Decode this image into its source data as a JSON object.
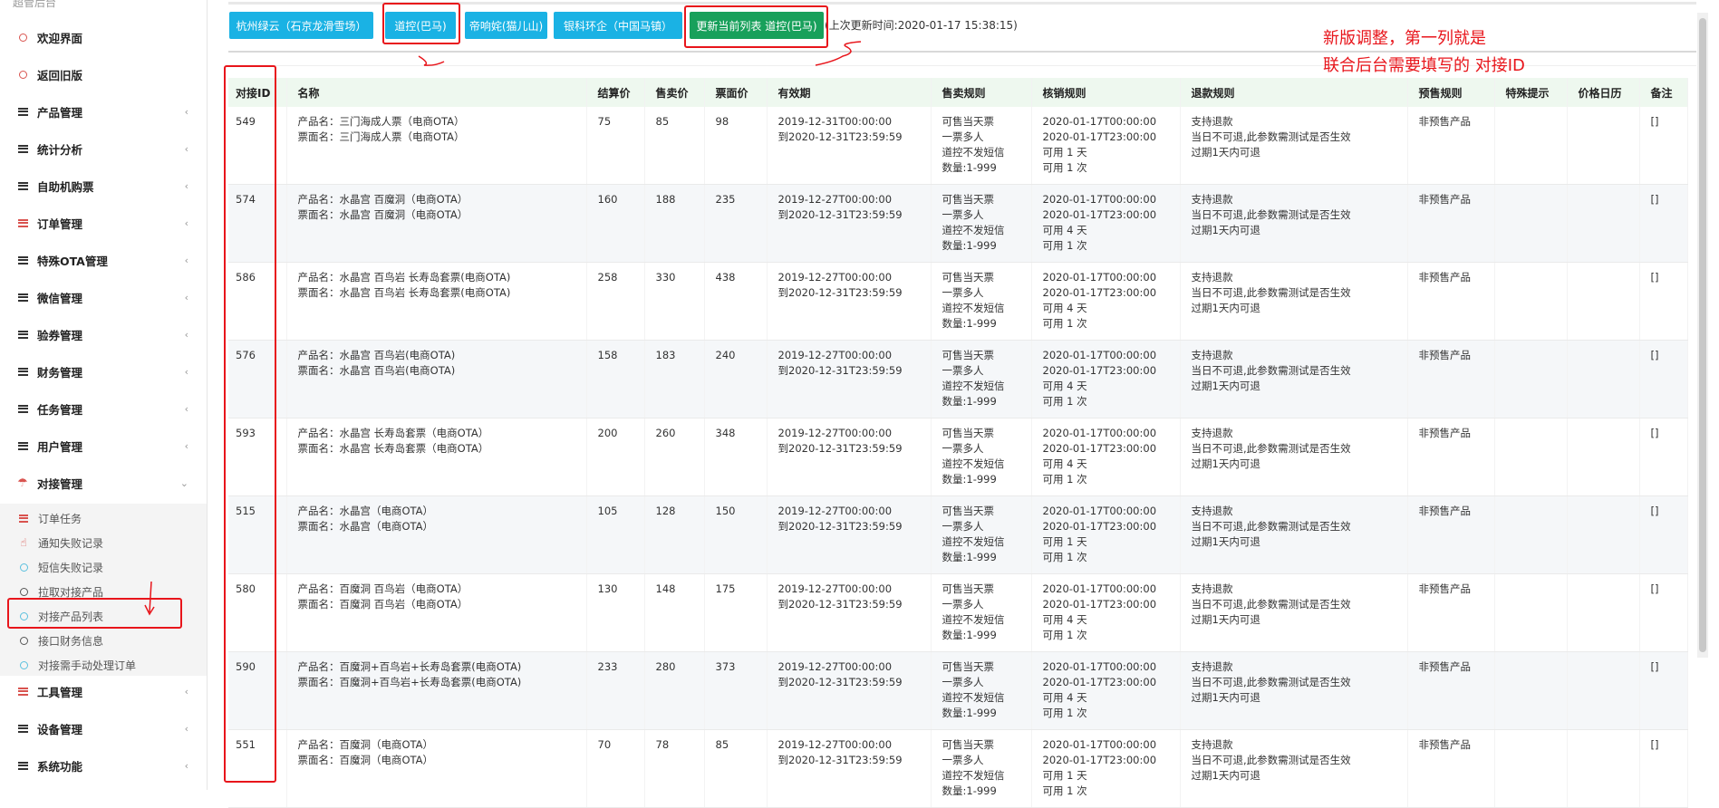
{
  "sidebar": {
    "top_label": "超管后台",
    "items": [
      {
        "label": "欢迎界面",
        "icon": "circle-icon",
        "chev": ""
      },
      {
        "label": "返回旧版",
        "icon": "circle-icon",
        "chev": ""
      },
      {
        "label": "产品管理",
        "icon": "menu-icon",
        "chev": "‹"
      },
      {
        "label": "统计分析",
        "icon": "menu-icon",
        "chev": "‹"
      },
      {
        "label": "自助机购票",
        "icon": "menu-icon",
        "chev": "‹"
      },
      {
        "label": "订单管理",
        "icon": "menu-icon-red",
        "chev": "‹"
      },
      {
        "label": "特殊OTA管理",
        "icon": "menu-icon",
        "chev": "‹"
      },
      {
        "label": "微信管理",
        "icon": "menu-icon",
        "chev": "‹"
      },
      {
        "label": "验券管理",
        "icon": "menu-icon",
        "chev": "‹"
      },
      {
        "label": "财务管理",
        "icon": "menu-icon",
        "chev": "‹"
      },
      {
        "label": "任务管理",
        "icon": "menu-icon",
        "chev": "‹"
      },
      {
        "label": "用户管理",
        "icon": "menu-icon",
        "chev": "‹"
      },
      {
        "label": "对接管理",
        "icon": "umbrella-icon",
        "chev": "⌄"
      }
    ],
    "sub_items": [
      {
        "label": "订单任务",
        "icon": "list-icon"
      },
      {
        "label": "通知失败记录",
        "icon": "hand-icon"
      },
      {
        "label": "短信失败记录",
        "icon": "circle-icon"
      },
      {
        "label": "拉取对接产品",
        "icon": "circle-icon"
      },
      {
        "label": "对接产品列表",
        "icon": "circle-icon"
      },
      {
        "label": "接口财务信息",
        "icon": "circle-icon"
      },
      {
        "label": "对接需手动处理订单",
        "icon": "circle-icon"
      }
    ],
    "bottom_items": [
      {
        "label": "工具管理",
        "icon": "menu-icon-red",
        "chev": "‹"
      },
      {
        "label": "设备管理",
        "icon": "menu-icon",
        "chev": "‹"
      },
      {
        "label": "系统功能",
        "icon": "menu-icon",
        "chev": "‹"
      }
    ]
  },
  "toolbar": {
    "buttons": [
      "杭州绿云（石京龙滑雪场）",
      "道控(巴马)",
      "帝响姹(猫儿山)",
      "银科环企（中国马镇）"
    ],
    "update_button": "更新当前列表 道控(巴马)",
    "last_update": "(上次更新时间:2020-01-17 15:38:15)"
  },
  "table": {
    "headers": [
      "对接ID",
      "名称",
      "结算价",
      "售卖价",
      "票面价",
      "有效期",
      "售卖规则",
      "核销规则",
      "退款规则",
      "预售规则",
      "特殊提示",
      "价格日历",
      "备注"
    ],
    "rows": [
      {
        "id": "549",
        "name": [
          "产品名：三门海成人票（电商OTA）",
          "票面名：三门海成人票（电商OTA）"
        ],
        "settle": "75",
        "sell": "85",
        "face": "98",
        "valid": [
          "2019-12-31T00:00:00",
          "到2020-12-31T23:59:59"
        ],
        "sale": [
          "可售当天票",
          "一票多人",
          "道控不发短信",
          "数量:1-999"
        ],
        "verify": [
          "2020-01-17T00:00:00",
          "2020-01-17T23:00:00",
          "可用 1 天",
          "可用 1 次"
        ],
        "refund": [
          "支持退款",
          "当日不可退,此参数需测试是否生效",
          "过期1天内可退"
        ],
        "presale": "非预售产品",
        "tip": "",
        "cal": "",
        "remark": "[]"
      },
      {
        "id": "574",
        "name": [
          "产品名：水晶宫 百魔洞（电商OTA）",
          "票面名：水晶宫 百魔洞（电商OTA）"
        ],
        "settle": "160",
        "sell": "188",
        "face": "235",
        "valid": [
          "2019-12-27T00:00:00",
          "到2020-12-31T23:59:59"
        ],
        "sale": [
          "可售当天票",
          "一票多人",
          "道控不发短信",
          "数量:1-999"
        ],
        "verify": [
          "2020-01-17T00:00:00",
          "2020-01-17T23:00:00",
          "可用 4 天",
          "可用 1 次"
        ],
        "refund": [
          "支持退款",
          "当日不可退,此参数需测试是否生效",
          "过期1天内可退"
        ],
        "presale": "非预售产品",
        "tip": "",
        "cal": "",
        "remark": "[]"
      },
      {
        "id": "586",
        "name": [
          "产品名：水晶宫 百鸟岩 长寿岛套票(电商OTA)",
          "票面名：水晶宫 百鸟岩 长寿岛套票(电商OTA)"
        ],
        "settle": "258",
        "sell": "330",
        "face": "438",
        "valid": [
          "2019-12-27T00:00:00",
          "到2020-12-31T23:59:59"
        ],
        "sale": [
          "可售当天票",
          "一票多人",
          "道控不发短信",
          "数量:1-999"
        ],
        "verify": [
          "2020-01-17T00:00:00",
          "2020-01-17T23:00:00",
          "可用 4 天",
          "可用 1 次"
        ],
        "refund": [
          "支持退款",
          "当日不可退,此参数需测试是否生效",
          "过期1天内可退"
        ],
        "presale": "非预售产品",
        "tip": "",
        "cal": "",
        "remark": "[]"
      },
      {
        "id": "576",
        "name": [
          "产品名：水晶宫 百鸟岩(电商OTA)",
          "票面名：水晶宫 百鸟岩(电商OTA)"
        ],
        "settle": "158",
        "sell": "183",
        "face": "240",
        "valid": [
          "2019-12-27T00:00:00",
          "到2020-12-31T23:59:59"
        ],
        "sale": [
          "可售当天票",
          "一票多人",
          "道控不发短信",
          "数量:1-999"
        ],
        "verify": [
          "2020-01-17T00:00:00",
          "2020-01-17T23:00:00",
          "可用 4 天",
          "可用 1 次"
        ],
        "refund": [
          "支持退款",
          "当日不可退,此参数需测试是否生效",
          "过期1天内可退"
        ],
        "presale": "非预售产品",
        "tip": "",
        "cal": "",
        "remark": "[]"
      },
      {
        "id": "593",
        "name": [
          "产品名：水晶宫 长寿岛套票（电商OTA）",
          "票面名：水晶宫 长寿岛套票（电商OTA）"
        ],
        "settle": "200",
        "sell": "260",
        "face": "348",
        "valid": [
          "2019-12-27T00:00:00",
          "到2020-12-31T23:59:59"
        ],
        "sale": [
          "可售当天票",
          "一票多人",
          "道控不发短信",
          "数量:1-999"
        ],
        "verify": [
          "2020-01-17T00:00:00",
          "2020-01-17T23:00:00",
          "可用 4 天",
          "可用 1 次"
        ],
        "refund": [
          "支持退款",
          "当日不可退,此参数需测试是否生效",
          "过期1天内可退"
        ],
        "presale": "非预售产品",
        "tip": "",
        "cal": "",
        "remark": "[]"
      },
      {
        "id": "515",
        "name": [
          "产品名：水晶宫（电商OTA）",
          "票面名：水晶宫（电商OTA）"
        ],
        "settle": "105",
        "sell": "128",
        "face": "150",
        "valid": [
          "2019-12-27T00:00:00",
          "到2020-12-31T23:59:59"
        ],
        "sale": [
          "可售当天票",
          "一票多人",
          "道控不发短信",
          "数量:1-999"
        ],
        "verify": [
          "2020-01-17T00:00:00",
          "2020-01-17T23:00:00",
          "可用 1 天",
          "可用 1 次"
        ],
        "refund": [
          "支持退款",
          "当日不可退,此参数需测试是否生效",
          "过期1天内可退"
        ],
        "presale": "非预售产品",
        "tip": "",
        "cal": "",
        "remark": "[]"
      },
      {
        "id": "580",
        "name": [
          "产品名：百魔洞 百鸟岩（电商OTA）",
          "票面名：百魔洞 百鸟岩（电商OTA）"
        ],
        "settle": "130",
        "sell": "148",
        "face": "175",
        "valid": [
          "2019-12-27T00:00:00",
          "到2020-12-31T23:59:59"
        ],
        "sale": [
          "可售当天票",
          "一票多人",
          "道控不发短信",
          "数量:1-999"
        ],
        "verify": [
          "2020-01-17T00:00:00",
          "2020-01-17T23:00:00",
          "可用 4 天",
          "可用 1 次"
        ],
        "refund": [
          "支持退款",
          "当日不可退,此参数需测试是否生效",
          "过期1天内可退"
        ],
        "presale": "非预售产品",
        "tip": "",
        "cal": "",
        "remark": "[]"
      },
      {
        "id": "590",
        "name": [
          "产品名：百魔洞+百鸟岩+长寿岛套票(电商OTA)",
          "票面名：百魔洞+百鸟岩+长寿岛套票(电商OTA)"
        ],
        "settle": "233",
        "sell": "280",
        "face": "373",
        "valid": [
          "2019-12-27T00:00:00",
          "到2020-12-31T23:59:59"
        ],
        "sale": [
          "可售当天票",
          "一票多人",
          "道控不发短信",
          "数量:1-999"
        ],
        "verify": [
          "2020-01-17T00:00:00",
          "2020-01-17T23:00:00",
          "可用 4 天",
          "可用 1 次"
        ],
        "refund": [
          "支持退款",
          "当日不可退,此参数需测试是否生效",
          "过期1天内可退"
        ],
        "presale": "非预售产品",
        "tip": "",
        "cal": "",
        "remark": "[]"
      },
      {
        "id": "551",
        "name": [
          "产品名：百魔洞（电商OTA）",
          "票面名：百魔洞（电商OTA）"
        ],
        "settle": "70",
        "sell": "78",
        "face": "85",
        "valid": [
          "2019-12-27T00:00:00",
          "到2020-12-31T23:59:59"
        ],
        "sale": [
          "可售当天票",
          "一票多人",
          "道控不发短信",
          "数量:1-999"
        ],
        "verify": [
          "2020-01-17T00:00:00",
          "2020-01-17T23:00:00",
          "可用 1 天",
          "可用 1 次"
        ],
        "refund": [
          "支持退款",
          "当日不可退,此参数需测试是否生效",
          "过期1天内可退"
        ],
        "presale": "非预售产品",
        "tip": "",
        "cal": "",
        "remark": "[]"
      }
    ]
  },
  "annotation": {
    "note_line1": "新版调整，第一列就是",
    "note_line2": "联合后台需要填写的 对接ID",
    "color": "#e8151b"
  }
}
